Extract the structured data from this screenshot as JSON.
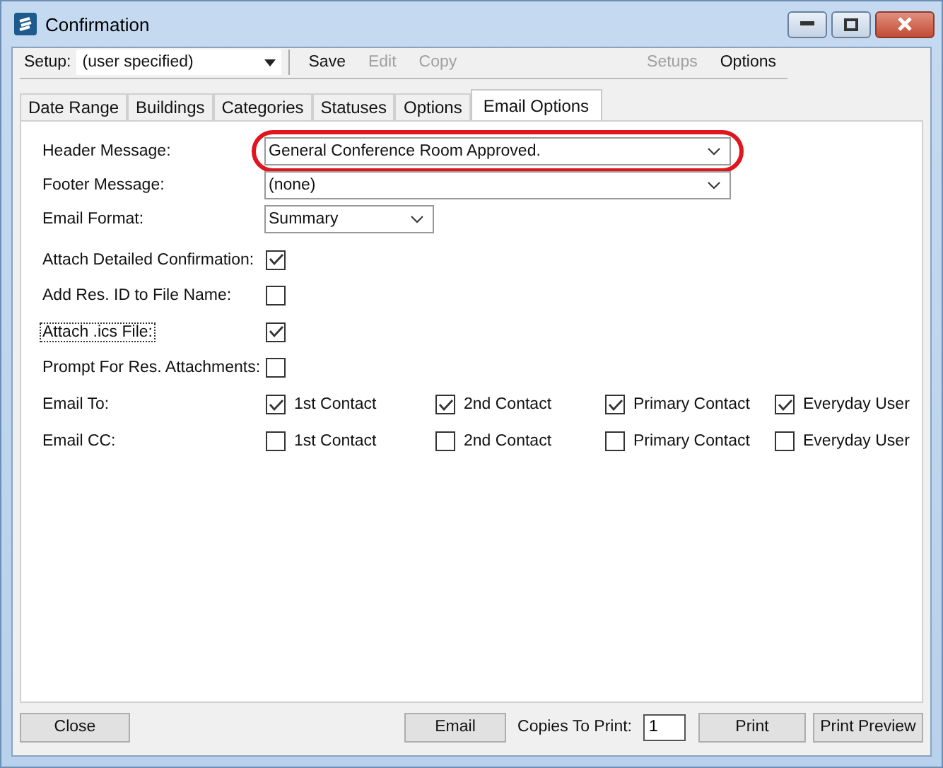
{
  "window": {
    "title": "Confirmation"
  },
  "toolbar": {
    "setup_label": "Setup:",
    "setup_value": "(user specified)",
    "buttons": [
      {
        "label": "Save",
        "disabled": false
      },
      {
        "label": "Edit",
        "disabled": true
      },
      {
        "label": "Copy",
        "disabled": true
      }
    ],
    "right_buttons": [
      {
        "label": "Setups",
        "disabled": true
      },
      {
        "label": "Options",
        "disabled": false
      }
    ]
  },
  "tabs": [
    {
      "label": "Date Range",
      "selected": false
    },
    {
      "label": "Buildings",
      "selected": false
    },
    {
      "label": "Categories",
      "selected": false
    },
    {
      "label": "Statuses",
      "selected": false
    },
    {
      "label": "Options",
      "selected": false
    },
    {
      "label": "Email Options",
      "selected": true
    }
  ],
  "form": [
    {
      "kind": "dropdown",
      "label": "Header Message:",
      "value": "General Conference Room Approved.",
      "wide": true,
      "highlighted": true
    },
    {
      "kind": "dropdown",
      "label": "Footer Message:",
      "value": "(none)",
      "wide": true,
      "highlighted": false
    },
    {
      "kind": "dropdown",
      "label": "Email Format:",
      "value": "Summary",
      "wide": false,
      "highlighted": false
    },
    {
      "kind": "checkbox",
      "label": "Attach Detailed Confirmation:",
      "checked": true,
      "focused": false
    },
    {
      "kind": "checkbox",
      "label": "Add Res. ID to File Name:",
      "checked": false,
      "focused": false
    },
    {
      "kind": "checkbox",
      "label": "Attach .ics File:",
      "checked": true,
      "focused": true
    },
    {
      "kind": "checkbox",
      "label": "Prompt For Res. Attachments:",
      "checked": false,
      "focused": false
    }
  ],
  "recipients": [
    {
      "label": "Email To:",
      "options": [
        {
          "label": "1st Contact",
          "checked": true
        },
        {
          "label": "2nd Contact",
          "checked": true
        },
        {
          "label": "Primary Contact",
          "checked": true
        },
        {
          "label": "Everyday User",
          "checked": true
        }
      ]
    },
    {
      "label": "Email CC:",
      "options": [
        {
          "label": "1st Contact",
          "checked": false
        },
        {
          "label": "2nd Contact",
          "checked": false
        },
        {
          "label": "Primary Contact",
          "checked": false
        },
        {
          "label": "Everyday User",
          "checked": false
        }
      ]
    }
  ],
  "footer": {
    "close": "Close",
    "email": "Email",
    "copies_label": "Copies To Print:",
    "copies_value": "1",
    "print": "Print",
    "print_preview": "Print Preview"
  }
}
